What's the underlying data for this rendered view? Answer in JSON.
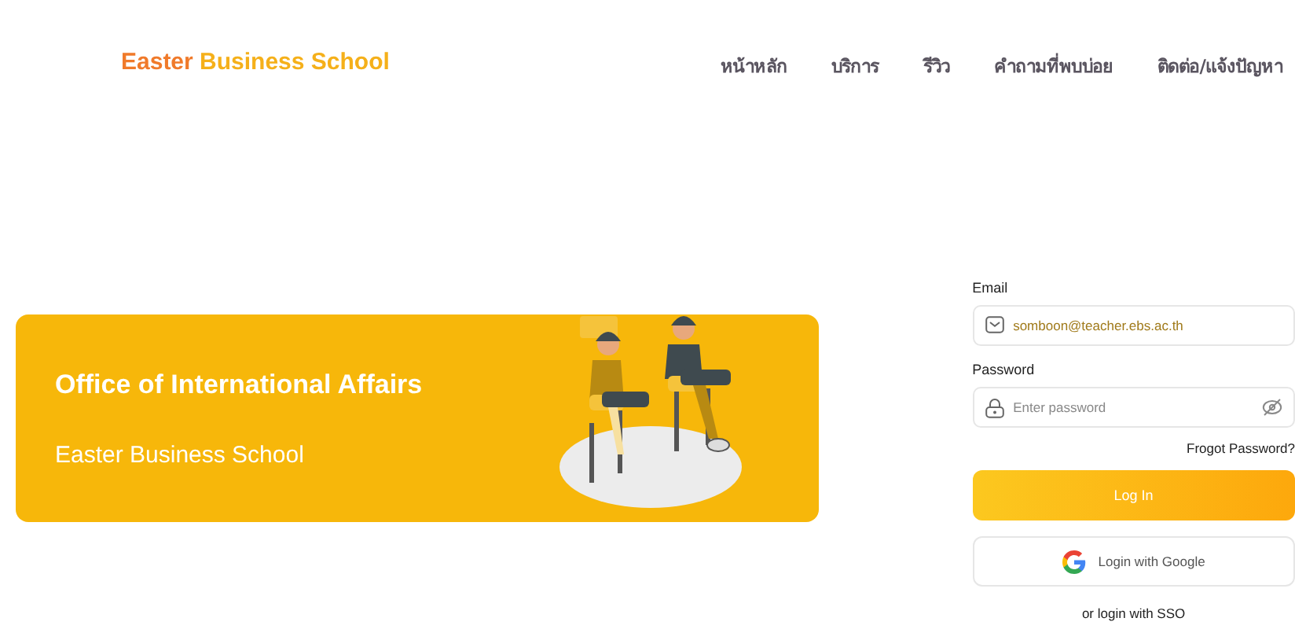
{
  "header": {
    "logo": {
      "part_1": "Easter",
      "part_2": "Business School"
    },
    "nav": [
      {
        "label": "หน้าหลัก"
      },
      {
        "label": "บริการ"
      },
      {
        "label": "รีวิว"
      },
      {
        "label": "คำถามที่พบบ่อย"
      },
      {
        "label": "ติดต่อ/แจ้งปัญหา"
      }
    ]
  },
  "banner": {
    "title": "Office of International Affairs",
    "subtitle": "Easter Business School"
  },
  "login": {
    "email_label": "Email",
    "email_value": "somboon@teacher.ebs.ac.th",
    "password_label": "Password",
    "password_placeholder": "Enter password",
    "forgot_link": "Frogot Password?",
    "login_button": "Log In",
    "google_button": "Login with Google",
    "sso_text": "or login with SSO"
  }
}
